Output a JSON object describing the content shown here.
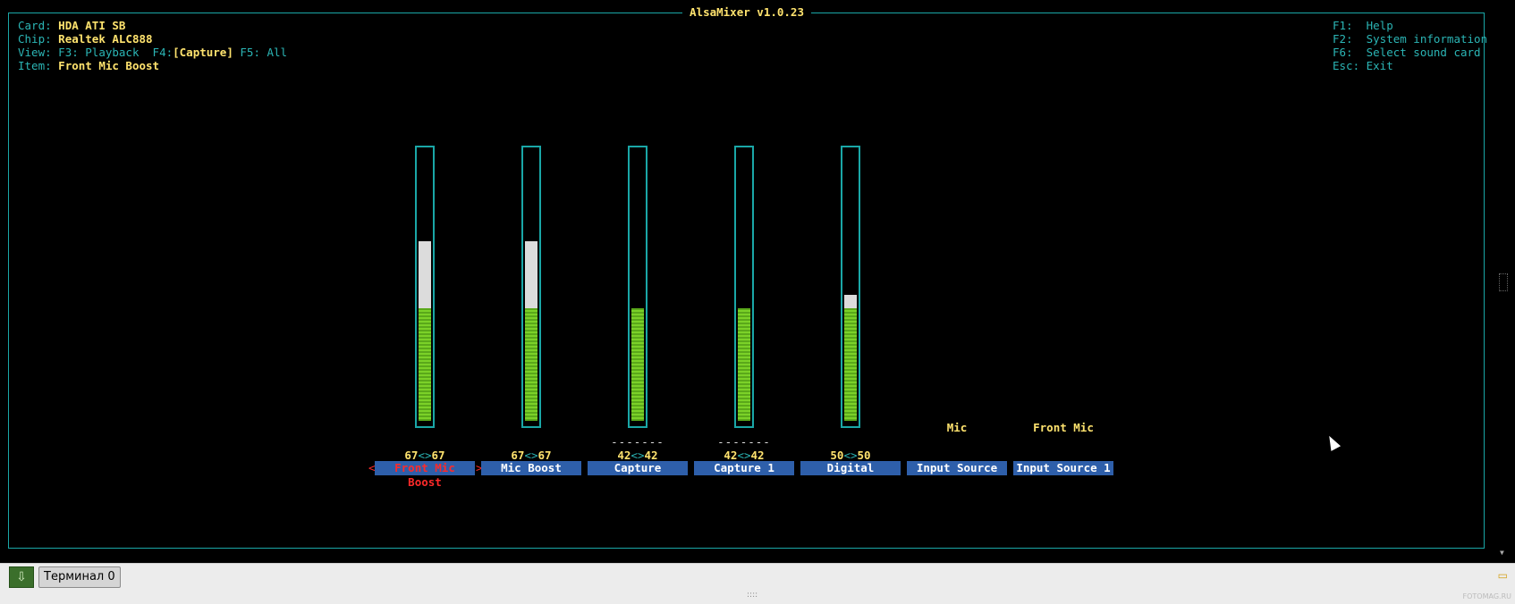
{
  "title": "AlsaMixer v1.0.23",
  "info": {
    "card_label": "Card:",
    "card": "HDA ATI SB",
    "chip_label": "Chip:",
    "chip": "Realtek ALC888",
    "view_label": "View:",
    "view_f3": "F3: Playback",
    "view_f4": "F4:",
    "view_current": "[Capture]",
    "view_f5": "F5: All",
    "item_label": "Item:",
    "item": "Front Mic Boost"
  },
  "keys": {
    "f1": "F1:  Help",
    "f2": "F2:  System information",
    "f6": "F6:  Select sound card",
    "esc": "Esc: Exit"
  },
  "controls": [
    {
      "label": "Front Mic Boost",
      "left": "67",
      "right": "67",
      "level": 0.67,
      "green": 0.42,
      "active": true,
      "mute": ""
    },
    {
      "label": "Mic Boost",
      "left": "67",
      "right": "67",
      "level": 0.67,
      "green": 0.42,
      "active": false,
      "mute": ""
    },
    {
      "label": "Capture",
      "left": "42",
      "right": "42",
      "level": 0.42,
      "green": 0.42,
      "active": false,
      "mute": "-------"
    },
    {
      "label": "Capture 1",
      "left": "42",
      "right": "42",
      "level": 0.42,
      "green": 0.42,
      "active": false,
      "mute": "-------"
    },
    {
      "label": "Digital",
      "left": "50",
      "right": "50",
      "level": 0.47,
      "green": 0.42,
      "active": false,
      "mute": ""
    }
  ],
  "sources": [
    {
      "label": "Input Source",
      "value": "Mic"
    },
    {
      "label": "Input Source 1",
      "value": "Front Mic"
    }
  ],
  "value_sep": "<>",
  "active_marker_left": "<",
  "active_marker_right": ">",
  "taskbar": {
    "task_label": "Терминал 0",
    "watermark": "FOTOMAG.RU"
  },
  "colors": {
    "cyan": "#1aa7a7",
    "yellow": "#ffe36e",
    "label_bg": "#2e5faa",
    "active_red": "#ff2a2a",
    "green": "#7bd128"
  }
}
